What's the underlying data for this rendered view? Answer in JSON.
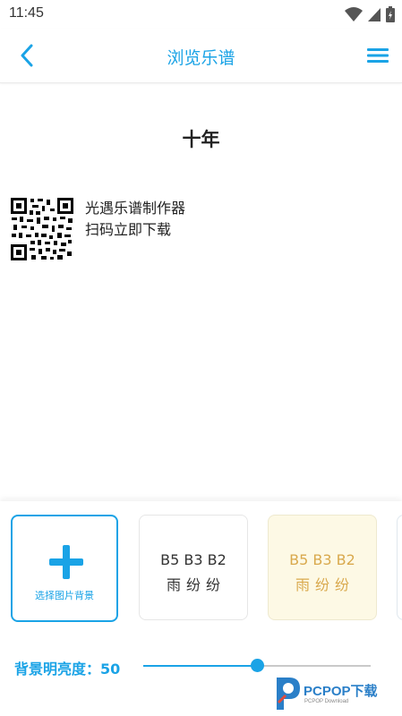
{
  "status_bar": {
    "time": "11:45"
  },
  "header": {
    "title": "浏览乐谱"
  },
  "score": {
    "title": "十年",
    "promo_line1": "光遇乐谱制作器",
    "promo_line2": "扫码立即下载"
  },
  "background_panel": {
    "add_label": "选择图片背景",
    "presets": [
      {
        "line1": "B5 B3 B2",
        "line2": "雨纷纷"
      },
      {
        "line1": "B5 B3 B2",
        "line2": "雨纷纷"
      }
    ]
  },
  "brightness": {
    "label": "背景明亮度：",
    "value": "50",
    "fraction": 0.5
  },
  "watermark": {
    "text": "PCPOP下载",
    "sub": "PCPOP Download"
  },
  "colors": {
    "accent": "#1aa3e6",
    "preset_highlight": "#d9a94d"
  }
}
